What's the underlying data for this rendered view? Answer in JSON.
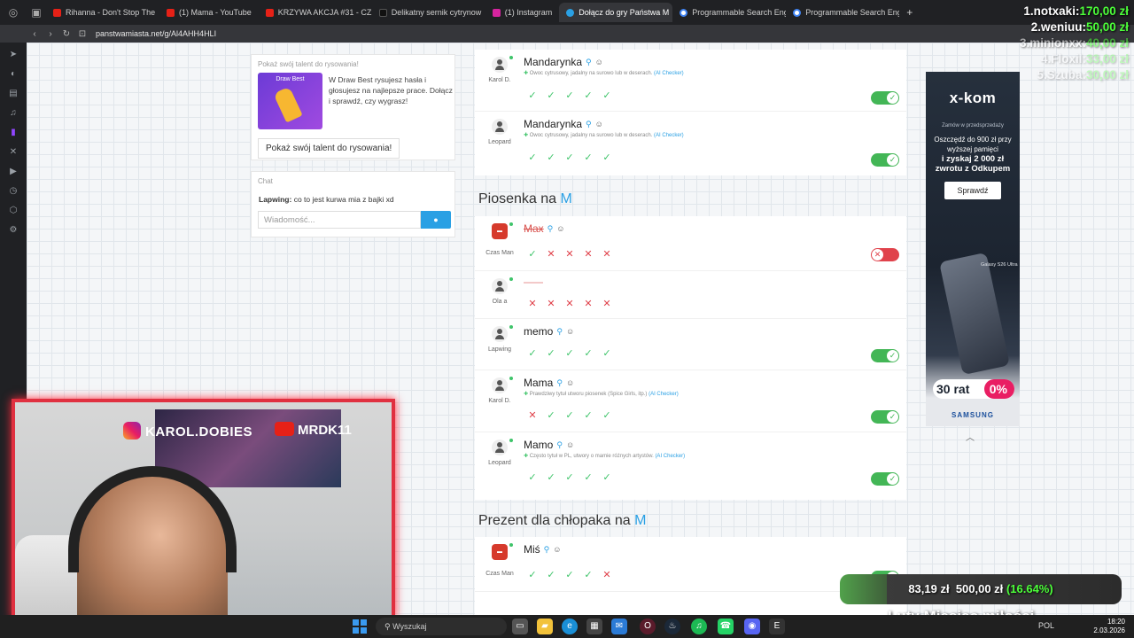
{
  "tabs": [
    {
      "label": "Rihanna - Don't Stop The",
      "color": "#e62117",
      "active": false
    },
    {
      "label": "(1) Mama - YouTube",
      "color": "#e62117",
      "active": false
    },
    {
      "label": "KRZYWA AKCJA #31 - CZ",
      "color": "#e62117",
      "active": false
    },
    {
      "label": "Delikatny sernik cytrynow",
      "color": "#111111",
      "active": false
    },
    {
      "label": "(1) Instagram",
      "color": "#d6249f",
      "active": false
    },
    {
      "label": "Dołącz do gry Państwa M",
      "color": "#2aa0e4",
      "active": true
    },
    {
      "label": "Programmable Search Eng",
      "color": "#4285f4",
      "active": false
    },
    {
      "label": "Programmable Search Eng",
      "color": "#4285f4",
      "active": false
    }
  ],
  "address": {
    "url": "panstwamiasta.net/g/Al4AHH4HLI"
  },
  "drawbest": {
    "title": "Pokaż swój talent do rysowania!",
    "thumb_label": "Draw Best",
    "text": "W Draw Best rysujesz hasła i głosujesz na najlepsze prace. Dołącz i sprawdź, czy wygrasz!",
    "button": "Pokaż swój talent do rysowania!"
  },
  "chat": {
    "title": "Chat",
    "author": "Lapwing:",
    "message": "co to jest kurwa mia z bajki xd",
    "placeholder": "Wiadomość..."
  },
  "categories": {
    "c1": {
      "title": "Piosenka na",
      "letter": "M"
    },
    "c2": {
      "title": "Prezent dla chłopaka na",
      "letter": "M"
    }
  },
  "answers": {
    "a1": {
      "word": "Mandarynka",
      "player": "Karol D.",
      "desc": "Owoc cytrusowy, jadalny na surowo lub w deserach.",
      "ai": "(AI Checker)"
    },
    "a2": {
      "word": "Mandarynka",
      "player": "Leopard",
      "desc": "Owoc cytrusowy, jadalny na surowo lub w deserach.",
      "ai": "(AI Checker)"
    },
    "b1": {
      "word": "Max",
      "player": "Czas Man"
    },
    "b2": {
      "word": "",
      "player": "Ola a"
    },
    "b3": {
      "word": "memo",
      "player": "Lapwing"
    },
    "b4": {
      "word": "Mama",
      "player": "Karol D.",
      "desc": "Prawdziwy tytuł utworu piosenek (Spice Girls, itp.)",
      "ai": "(AI Checker)"
    },
    "b5": {
      "word": "Mamo",
      "player": "Leopard",
      "desc": "Często tytuł w PL, utwory o mamie różnych artystów.",
      "ai": "(AI Checker)"
    },
    "c1": {
      "word": "Miś",
      "player": "Czas Man"
    }
  },
  "ad": {
    "logo": "x-kom",
    "pre": "Zamów w przedsprzedaży",
    "line1": "Oszczędź do 900 zł przy wyższej pamięci",
    "line2": "i zyskaj 2 000 zł zwrotu z Odkupem",
    "cta": "Sprawdź",
    "phone": "Galaxy S26 Ultra",
    "rat": "30 rat",
    "pct": "0%",
    "brand": "SAMSUNG"
  },
  "leaderboard": [
    {
      "label": "1.notxaki:",
      "amount": "170,00 zł"
    },
    {
      "label": "2.weniuu:",
      "amount": "50,00 zł"
    },
    {
      "label": "3.minionxx:",
      "amount": "40,00 zł"
    },
    {
      "label": "4.Floxil:",
      "amount": "33,00 zł"
    },
    {
      "label": "5.Szuba:",
      "amount": "30,00 zł"
    }
  ],
  "webcam": {
    "instagram": "KAROL.DOBIES",
    "youtube": "MRDK11"
  },
  "donation": {
    "current": "83,19 zł",
    "goal": "500,00 zł",
    "percent": "(16.64%)",
    "progress": 0.1664
  },
  "month_banner": "Luty Miesiąc miłości",
  "taskbar": {
    "search": "Wyszukaj",
    "lang": "POL",
    "time": "18:20",
    "date": "2.03.2026"
  }
}
